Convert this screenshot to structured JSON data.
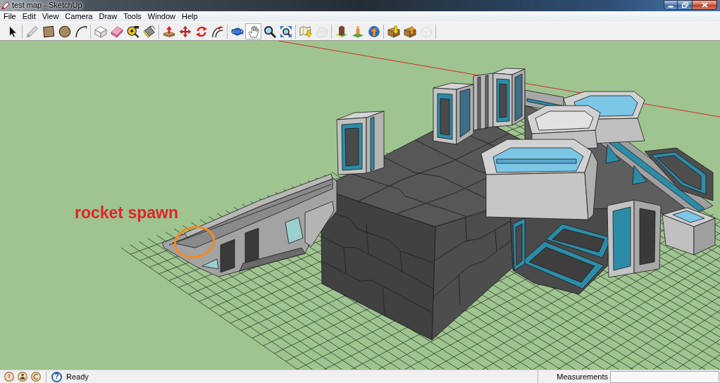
{
  "window": {
    "title": "test map - SketchUp"
  },
  "menu": [
    "File",
    "Edit",
    "View",
    "Camera",
    "Draw",
    "Tools",
    "Window",
    "Help"
  ],
  "toolbar": {
    "groups": [
      {
        "tools": [
          {
            "kind": "select",
            "selected": false,
            "disabled": false
          }
        ]
      },
      {
        "tools": [
          {
            "kind": "line",
            "selected": false,
            "disabled": false
          },
          {
            "kind": "rectangle",
            "selected": false,
            "disabled": false
          },
          {
            "kind": "circle",
            "selected": false,
            "disabled": false
          },
          {
            "kind": "arc",
            "selected": false,
            "disabled": false
          }
        ]
      },
      {
        "tools": [
          {
            "kind": "component",
            "selected": false,
            "disabled": false
          },
          {
            "kind": "eraser",
            "selected": false,
            "disabled": false
          },
          {
            "kind": "tape-measure",
            "selected": false,
            "disabled": false
          },
          {
            "kind": "paint-bucket",
            "selected": false,
            "disabled": false
          }
        ]
      },
      {
        "tools": [
          {
            "kind": "push-pull",
            "selected": false,
            "disabled": false
          },
          {
            "kind": "move",
            "selected": false,
            "disabled": false
          },
          {
            "kind": "rotate",
            "selected": false,
            "disabled": false
          },
          {
            "kind": "offset",
            "selected": false,
            "disabled": false
          }
        ]
      },
      {
        "tools": [
          {
            "kind": "orbit",
            "selected": false,
            "disabled": false
          },
          {
            "kind": "pan",
            "selected": true,
            "disabled": false
          },
          {
            "kind": "zoom",
            "selected": false,
            "disabled": false
          },
          {
            "kind": "zoom-extents",
            "selected": false,
            "disabled": false
          }
        ]
      },
      {
        "tools": [
          {
            "kind": "map-import",
            "selected": false,
            "disabled": false
          },
          {
            "kind": "terrain",
            "selected": false,
            "disabled": true
          }
        ]
      },
      {
        "tools": [
          {
            "kind": "earth-preview",
            "selected": false,
            "disabled": false
          },
          {
            "kind": "earth-place",
            "selected": false,
            "disabled": false
          },
          {
            "kind": "earth-globe",
            "selected": false,
            "disabled": false
          }
        ]
      },
      {
        "tools": [
          {
            "kind": "get-models",
            "selected": false,
            "disabled": false
          },
          {
            "kind": "share-model",
            "selected": false,
            "disabled": false
          },
          {
            "kind": "share-component",
            "selected": false,
            "disabled": true
          }
        ]
      }
    ]
  },
  "viewport": {
    "annotation": "rocket spawn"
  },
  "status_bar": {
    "help": "?",
    "message": "Ready",
    "measurements_label": "Measurements"
  }
}
